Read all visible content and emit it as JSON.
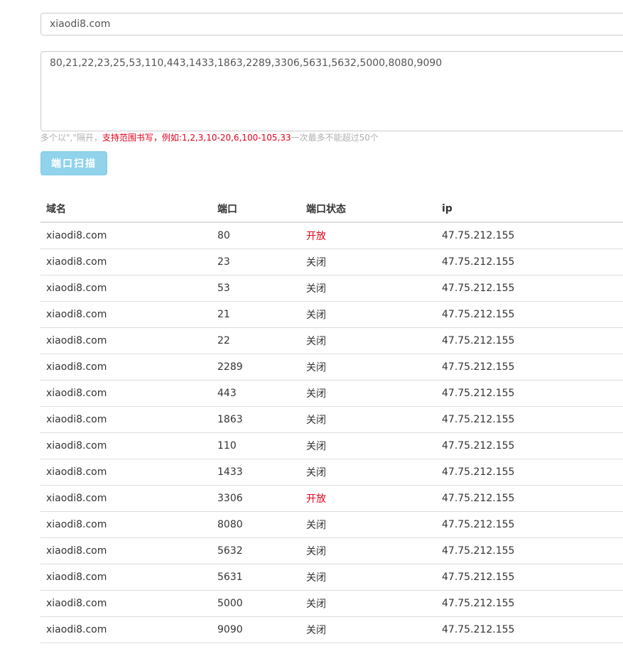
{
  "form": {
    "domain_value": "xiaodi8.com",
    "ports_value": "80,21,22,23,25,53,110,443,1433,1863,2289,3306,5631,5632,5000,8080,9090",
    "help_prefix": "多个以\",\"隔开，",
    "help_range": "支持范围书写，例如:1,2,3,10-20,6,100-105,33",
    "help_suffix": "一次最多不能超过50个",
    "scan_label": "端口扫描"
  },
  "colors": {
    "open_status": "#e5001a",
    "button_bg": "#90d3ea"
  },
  "table": {
    "headers": {
      "domain": "域名",
      "port": "端口",
      "status": "端口状态",
      "ip": "ip"
    },
    "rows": [
      {
        "domain": "xiaodi8.com",
        "port": "80",
        "status": "开放",
        "open": true,
        "ip": "47.75.212.155"
      },
      {
        "domain": "xiaodi8.com",
        "port": "23",
        "status": "关闭",
        "open": false,
        "ip": "47.75.212.155"
      },
      {
        "domain": "xiaodi8.com",
        "port": "53",
        "status": "关闭",
        "open": false,
        "ip": "47.75.212.155"
      },
      {
        "domain": "xiaodi8.com",
        "port": "21",
        "status": "关闭",
        "open": false,
        "ip": "47.75.212.155"
      },
      {
        "domain": "xiaodi8.com",
        "port": "22",
        "status": "关闭",
        "open": false,
        "ip": "47.75.212.155"
      },
      {
        "domain": "xiaodi8.com",
        "port": "2289",
        "status": "关闭",
        "open": false,
        "ip": "47.75.212.155"
      },
      {
        "domain": "xiaodi8.com",
        "port": "443",
        "status": "关闭",
        "open": false,
        "ip": "47.75.212.155"
      },
      {
        "domain": "xiaodi8.com",
        "port": "1863",
        "status": "关闭",
        "open": false,
        "ip": "47.75.212.155"
      },
      {
        "domain": "xiaodi8.com",
        "port": "110",
        "status": "关闭",
        "open": false,
        "ip": "47.75.212.155"
      },
      {
        "domain": "xiaodi8.com",
        "port": "1433",
        "status": "关闭",
        "open": false,
        "ip": "47.75.212.155"
      },
      {
        "domain": "xiaodi8.com",
        "port": "3306",
        "status": "开放",
        "open": true,
        "ip": "47.75.212.155"
      },
      {
        "domain": "xiaodi8.com",
        "port": "8080",
        "status": "关闭",
        "open": false,
        "ip": "47.75.212.155"
      },
      {
        "domain": "xiaodi8.com",
        "port": "5632",
        "status": "关闭",
        "open": false,
        "ip": "47.75.212.155"
      },
      {
        "domain": "xiaodi8.com",
        "port": "5631",
        "status": "关闭",
        "open": false,
        "ip": "47.75.212.155"
      },
      {
        "domain": "xiaodi8.com",
        "port": "5000",
        "status": "关闭",
        "open": false,
        "ip": "47.75.212.155"
      },
      {
        "domain": "xiaodi8.com",
        "port": "9090",
        "status": "关闭",
        "open": false,
        "ip": "47.75.212.155"
      }
    ]
  }
}
